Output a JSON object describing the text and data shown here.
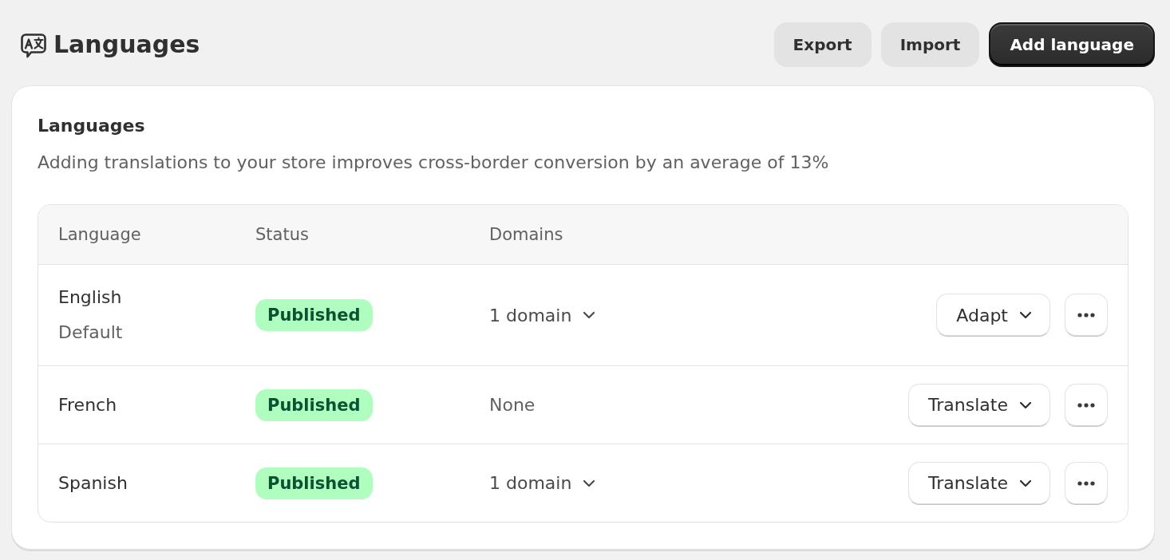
{
  "page_header": {
    "title": "Languages",
    "actions": [
      {
        "label": "Export",
        "kind": "secondary"
      },
      {
        "label": "Import",
        "kind": "secondary"
      },
      {
        "label": "Add language",
        "kind": "primary"
      }
    ]
  },
  "card": {
    "title": "Languages",
    "description": "Adding translations to your store improves cross-border conversion by an average of 13%",
    "table": {
      "columns": [
        "Language",
        "Status",
        "Domains"
      ],
      "rows": [
        {
          "language": "English",
          "note": "Default",
          "status": {
            "label": "Published",
            "kind": "success"
          },
          "domains": {
            "label": "1 domain",
            "kind": "dropdown"
          },
          "action": "Adapt"
        },
        {
          "language": "French",
          "status": {
            "label": "Published",
            "kind": "success"
          },
          "domains": {
            "label": "None",
            "kind": "text"
          },
          "action": "Translate"
        },
        {
          "language": "Spanish",
          "status": {
            "label": "Published",
            "kind": "success"
          },
          "domains": {
            "label": "1 domain",
            "kind": "dropdown"
          },
          "action": "Translate"
        }
      ]
    }
  }
}
